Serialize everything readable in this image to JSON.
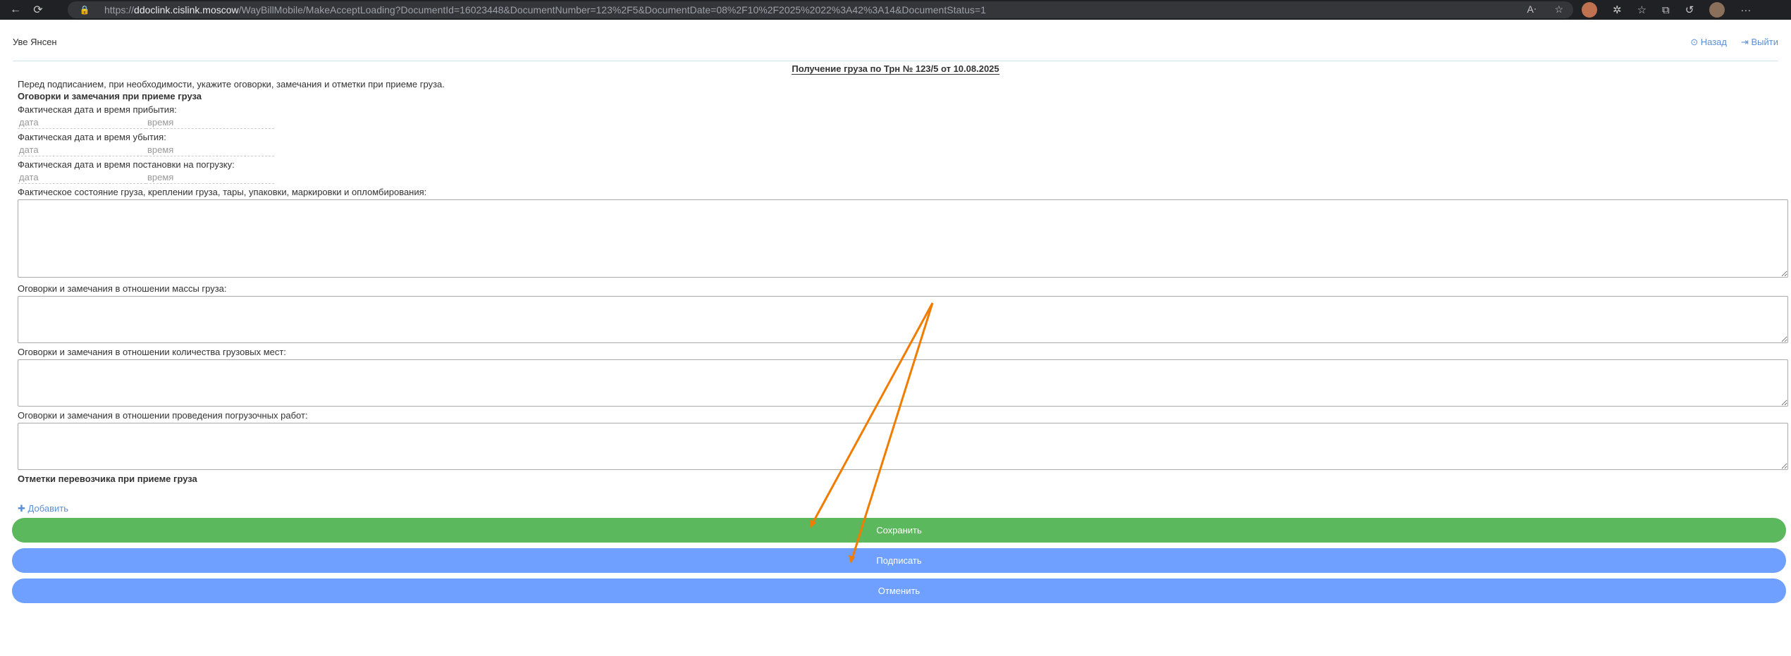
{
  "browser": {
    "url_prefix": "https://",
    "url_host": "ddoclink.cislink.moscow",
    "url_path": "/WayBillMobile/MakeAcceptLoading?DocumentId=16023448&DocumentNumber=123%2F5&DocumentDate=08%2F10%2F2025%2022%3A42%3A14&DocumentStatus=1"
  },
  "header": {
    "user_name": "Уве Янсен",
    "back_label": "Назад",
    "logout_label": "Выйти"
  },
  "document": {
    "title": "Получение груза по Трн № 123/5 от 10.08.2025"
  },
  "form": {
    "intro": "Перед подписанием, при необходимости, укажите оговорки, замечания и отметки при приеме груза.",
    "remarks_heading": "Оговорки и замечания при приеме груза",
    "arrival_label": "Фактическая дата и время прибытия:",
    "departure_label": "Фактическая дата и время убытия:",
    "loading_label": "Фактическая дата и время постановки на погрузку:",
    "date_placeholder": "дата",
    "time_placeholder": "время",
    "cargo_state_label": "Фактическое состояние груза, креплении груза, тары, упаковки, маркировки и опломбирования:",
    "mass_label": "Оговорки и замечания в отношении массы груза:",
    "places_label": "Оговорки и замечания в отношении количества грузовых мест:",
    "works_label": "Оговорки и замечания в отношении проведения погрузочных работ:",
    "carrier_heading": "Отметки перевозчика при приеме груза",
    "add_label": "Добавить"
  },
  "actions": {
    "save": "Сохранить",
    "sign": "Подписать",
    "cancel": "Отменить"
  },
  "colors": {
    "save": "#5cb85c",
    "primary": "#70a0ff",
    "link": "#5b8fd6",
    "annotation_arrow": "#f07c00"
  }
}
